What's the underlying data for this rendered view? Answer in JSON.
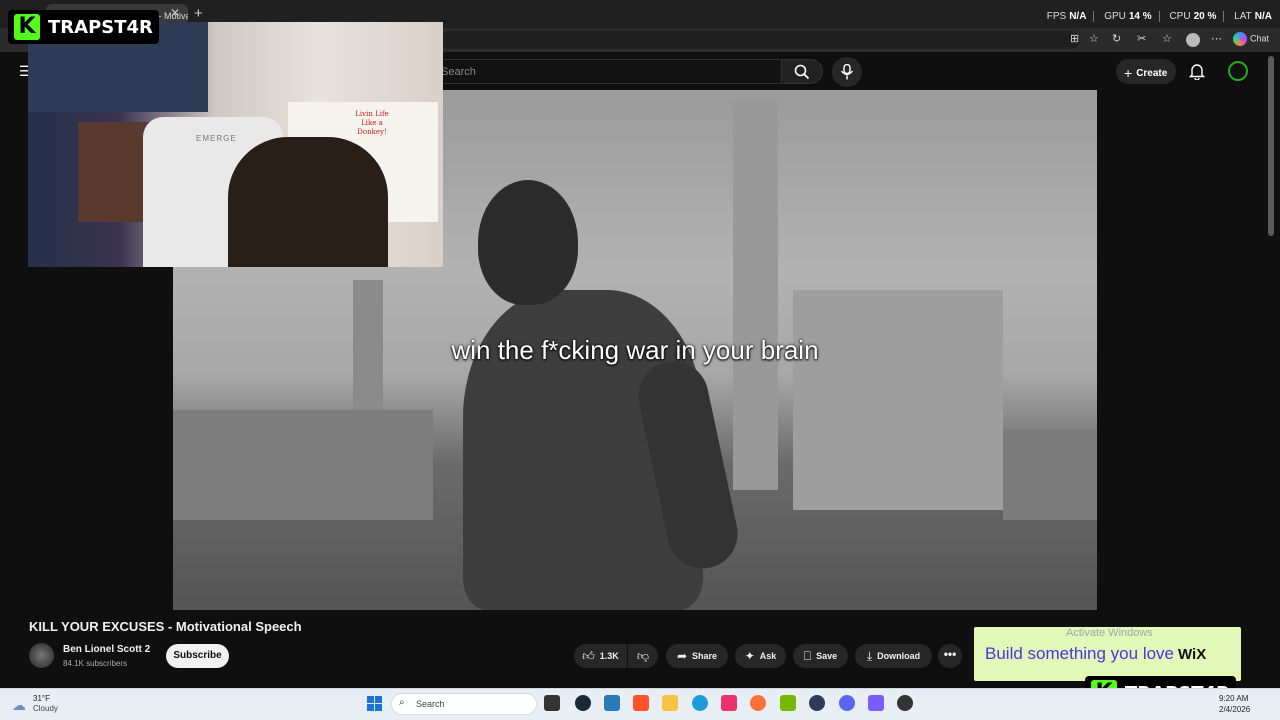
{
  "browser": {
    "tab_title": "KILL YOUR EXCUSES - Motiva",
    "chat_label": "Chat"
  },
  "perf": [
    {
      "label": "FPS",
      "value": "N/A"
    },
    {
      "label": "GPU",
      "value": "14 %"
    },
    {
      "label": "CPU",
      "value": "20 %"
    },
    {
      "label": "LAT",
      "value": "N/A"
    }
  ],
  "youtube": {
    "search_placeholder": "Search",
    "create_label": "Create"
  },
  "video": {
    "subtitle": "win the f*cking war in your brain",
    "title": "KILL YOUR EXCUSES - Motivational Speech",
    "channel_name": "Ben Lionel Scott 2",
    "subscribers": "84.1K subscribers",
    "subscribe_label": "Subscribe",
    "actions": {
      "like_count": "1.3K",
      "share": "Share",
      "ask": "Ask",
      "save": "Save",
      "download": "Download",
      "more": "•••"
    }
  },
  "webcam": {
    "poster_text": "Livin Life Like a Donkey!",
    "chair_brand": "EMERGE"
  },
  "kick": {
    "k": "K",
    "name": "TRAPST4R"
  },
  "ad": {
    "text": "Build something you love",
    "brand": "WiX"
  },
  "watermark": "Activate Windows",
  "taskbar": {
    "weather_temp": "31°F",
    "weather_desc": "Cloudy",
    "search_label": "Search",
    "time": "9:20 AM",
    "date": "2/4/2026"
  },
  "colors": {
    "kick_green": "#53fc18",
    "yt_bg": "#0f0f0f",
    "ad_bg": "#e3f7b8",
    "ad_text": "#4b35e0"
  }
}
